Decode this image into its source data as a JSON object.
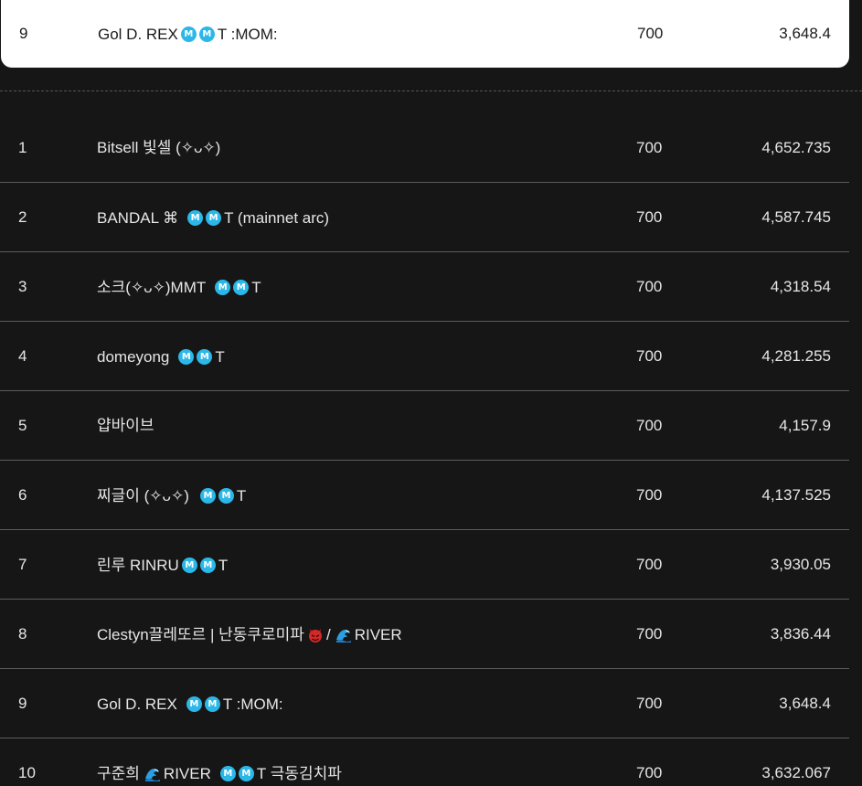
{
  "highlight": {
    "rank": "9",
    "name_prefix": "Gol D. REX",
    "name_suffix": "T :MOM:",
    "level": "700",
    "score": "3,648.4"
  },
  "rows": [
    {
      "rank": "1",
      "name": "Bitsell 빛셀 (✧ᴗ✧)",
      "level": "700",
      "score": "4,652.735"
    },
    {
      "rank": "2",
      "name_prefix": "BANDAL ⌘",
      "name_suffix": "T (mainnet arc)",
      "level": "700",
      "score": "4,587.745"
    },
    {
      "rank": "3",
      "name_prefix": "소크(✧ᴗ✧)MMT",
      "name_suffix": "T",
      "level": "700",
      "score": "4,318.54"
    },
    {
      "rank": "4",
      "name_prefix": "domeyong",
      "name_suffix": "T",
      "level": "700",
      "score": "4,281.255"
    },
    {
      "rank": "5",
      "name": "얍바이브",
      "level": "700",
      "score": "4,157.9"
    },
    {
      "rank": "6",
      "name_prefix": "찌글이 (✧ᴗ✧)",
      "name_suffix": "T",
      "level": "700",
      "score": "4,137.525"
    },
    {
      "rank": "7",
      "name_prefix": "린루 RINRU",
      "name_suffix": "T",
      "level": "700",
      "score": "3,930.05"
    },
    {
      "rank": "8",
      "name_prefix": "Clestyn끌레또르 | 난동쿠로미파",
      "name_mid": "/",
      "name_suffix": "RIVER",
      "level": "700",
      "score": "3,836.44"
    },
    {
      "rank": "9",
      "name_prefix": "Gol D. REX",
      "name_suffix": "T :MOM:",
      "level": "700",
      "score": "3,648.4"
    },
    {
      "rank": "10",
      "name_prefix": "구준희",
      "name_mid": "RIVER",
      "name_suffix": "T 극동김치파",
      "level": "700",
      "score": "3,632.067"
    }
  ],
  "icons": {
    "m_badge": "M",
    "m_badge_color": "#2bb8e8",
    "wave": "wave-icon",
    "devil": "devil-icon"
  }
}
